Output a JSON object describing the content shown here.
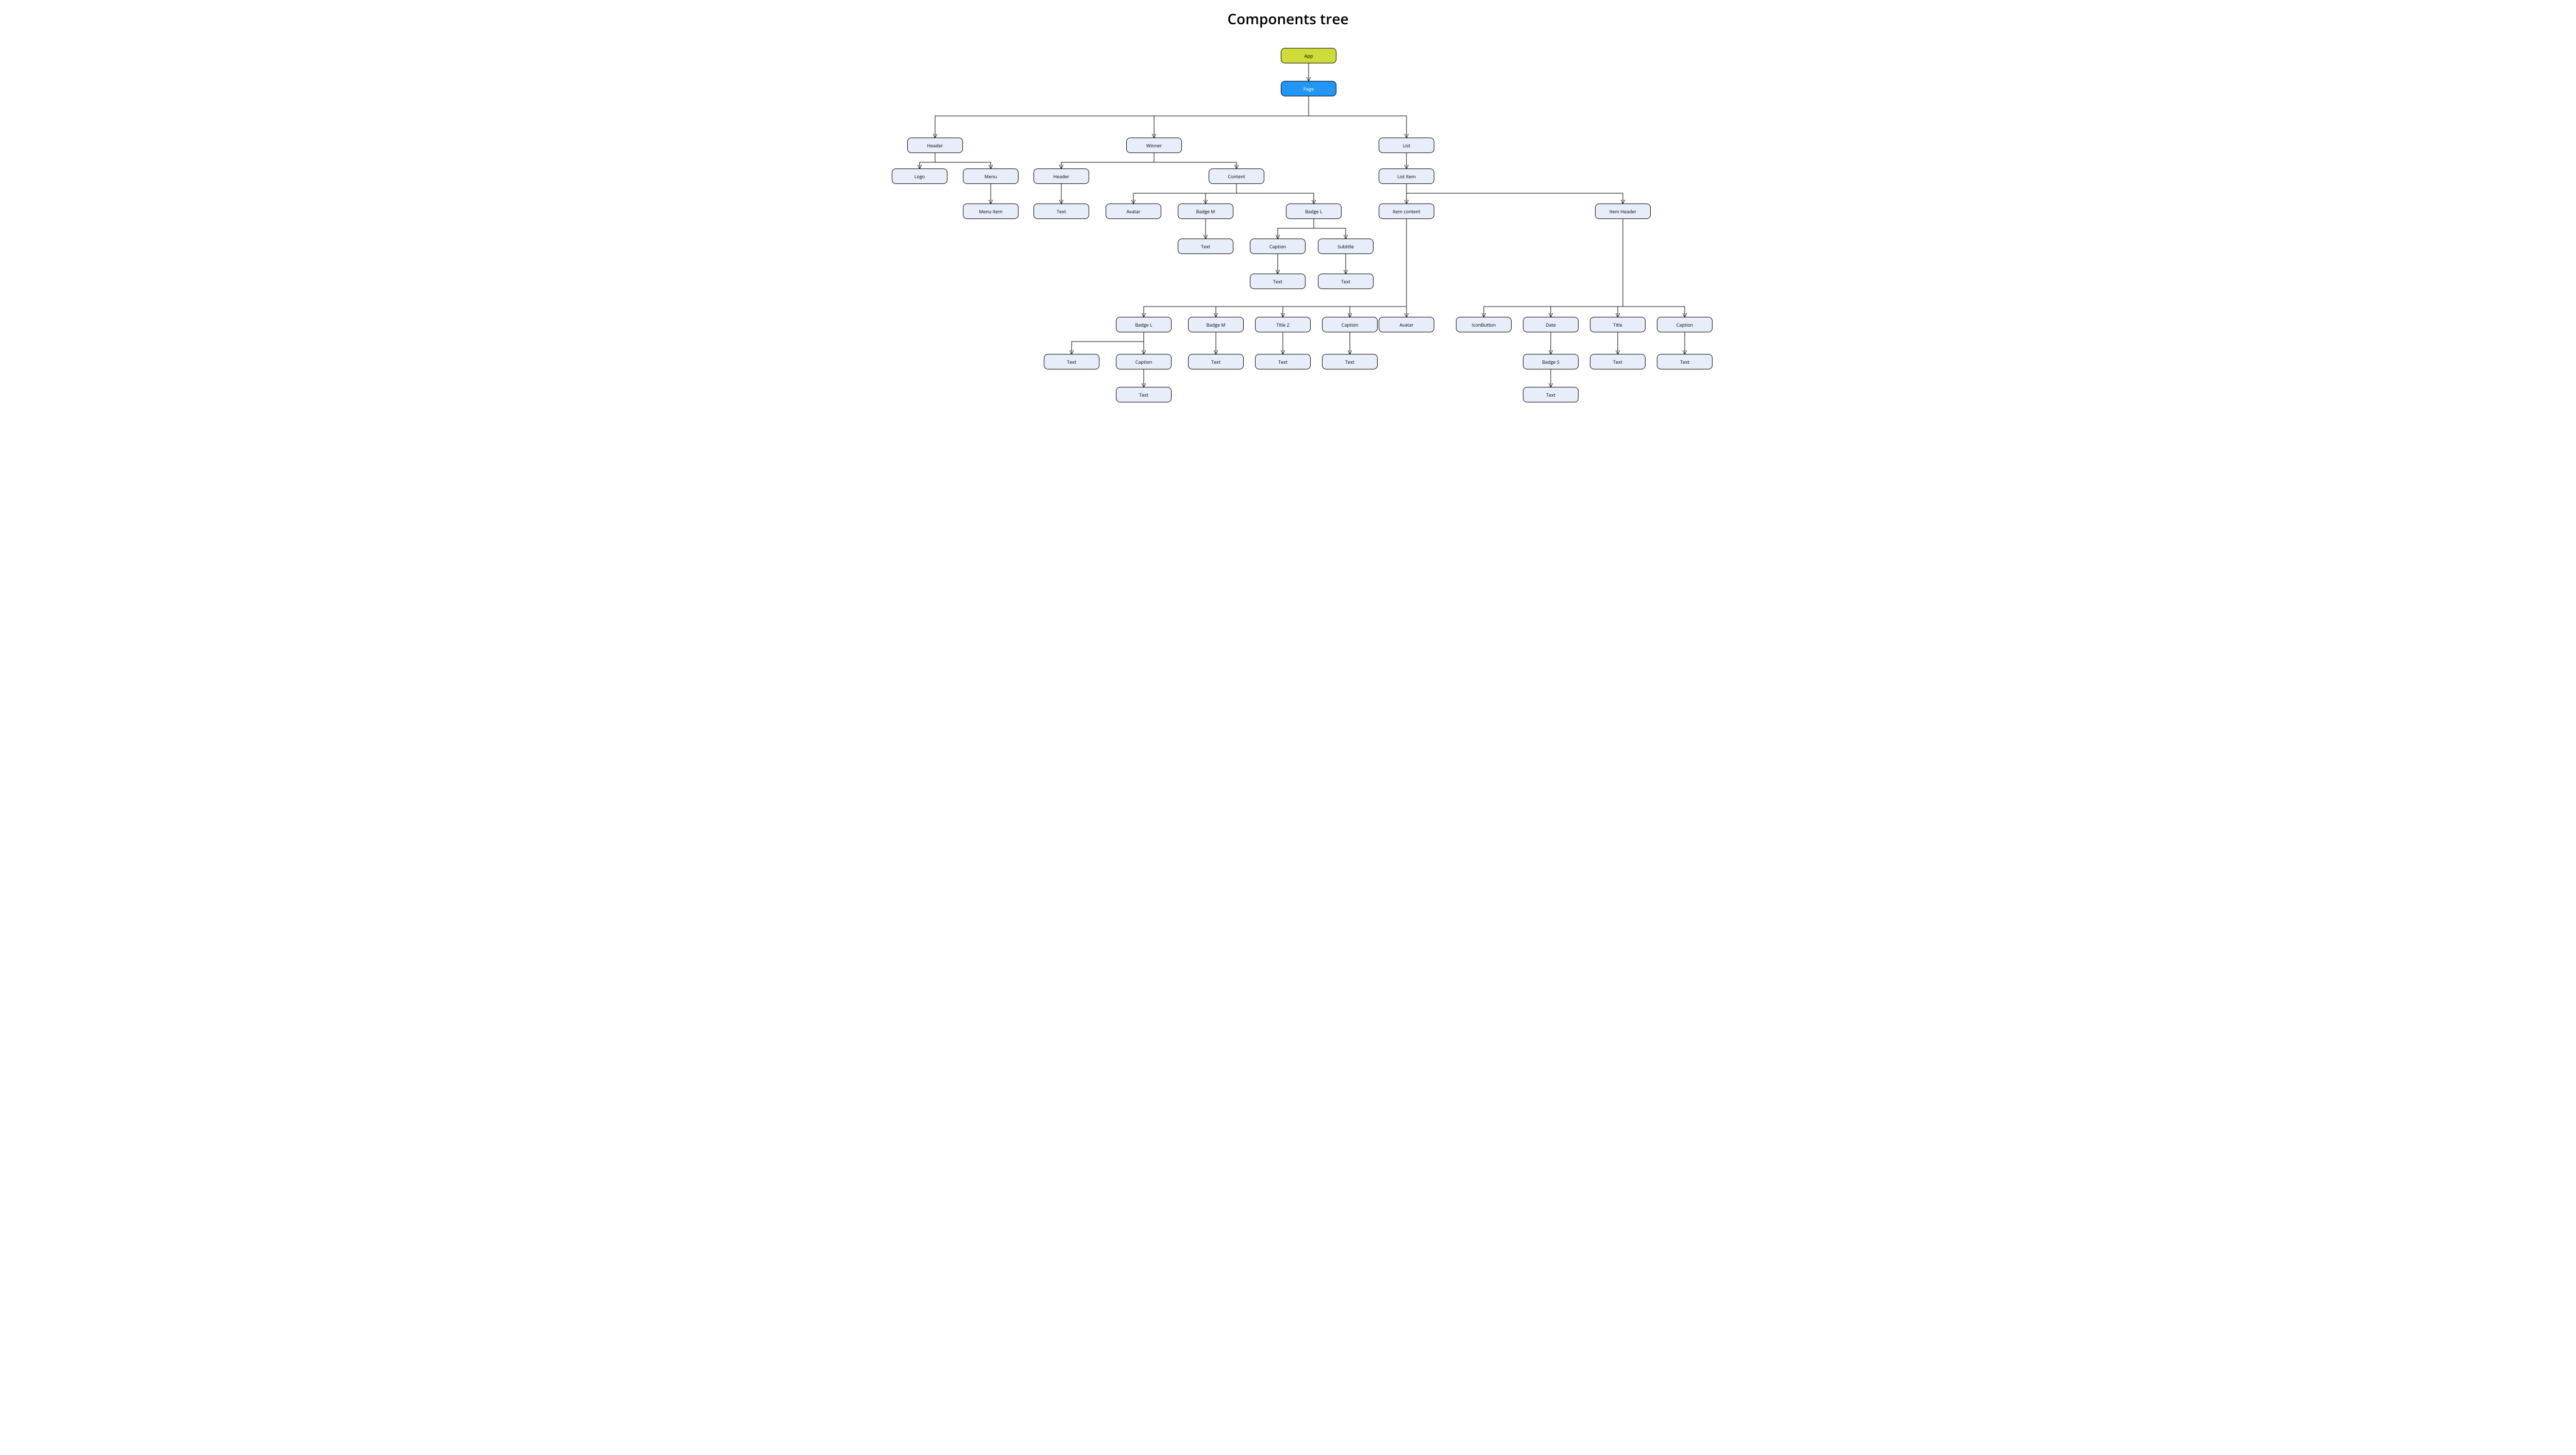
{
  "title": "Components tree",
  "nodes": {
    "app": "App",
    "page": "Page",
    "header": "Header",
    "logo": "Logo",
    "menu": "Menu",
    "menu_item": "Menu Item",
    "winner": "Winner",
    "w_header": "Header",
    "w_text": "Text",
    "content": "Content",
    "avatar": "Avatar",
    "badge_m": "Badge M",
    "bm_text": "Text",
    "badge_l": "Badge L",
    "bl_caption": "Caption",
    "bl_subtitle": "Subtitle",
    "bl_cap_text": "Text",
    "bl_sub_text": "Text",
    "list": "List",
    "list_item": "List Item",
    "item_content": "Item content",
    "ic_badge_l": "Badge L",
    "ic_bl_text": "Text",
    "ic_bl_caption": "Caption",
    "ic_bl_cap_text": "Text",
    "ic_badge_m": "Badge M",
    "ic_bm_text": "Text",
    "ic_title2": "Title 2",
    "ic_t2_text": "Text",
    "ic_caption": "Caption",
    "ic_cap_text": "Text",
    "ic_avatar": "Avatar",
    "item_header": "Item Header",
    "ih_iconbutton": "IconButton",
    "ih_date": "Date",
    "ih_badge_s": "Badge S",
    "ih_bs_text": "Text",
    "ih_title": "Title",
    "ih_t_text": "Text",
    "ih_caption": "Caption",
    "ih_c_text": "Text"
  }
}
